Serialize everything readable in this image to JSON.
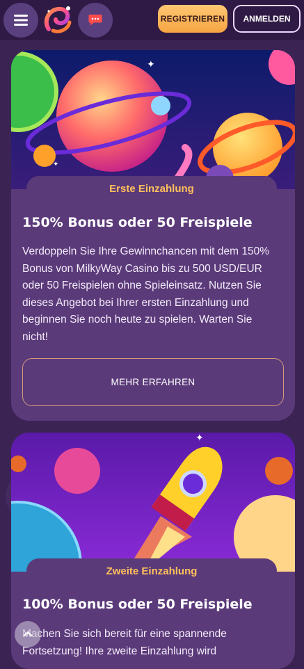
{
  "header": {
    "register_label": "REGISTRIEREN",
    "login_label": "ANMELDEN"
  },
  "cards": [
    {
      "tab_label": "Erste Einzahlung",
      "title": "150% Bonus oder 50 Freispiele",
      "text": "Verdoppeln Sie Ihre Gewinnchancen mit dem 150% Bonus von MilkyWay Casino bis zu 500 USD/EUR oder 50 Freispielen ohne Spieleinsatz. Nutzen Sie dieses Angebot bei Ihrer ersten Einzahlung und beginnen Sie noch heute zu spielen. Warten Sie nicht!",
      "button_label": "MEHR ERFAHREN"
    },
    {
      "tab_label": "Zweite Einzahlung",
      "title": "100% Bonus oder 50 Freispiele",
      "text": "Machen Sie sich bereit für eine spannende Fortsetzung! Ihre zweite Einzahlung wird"
    }
  ],
  "colors": {
    "background": "#3b2454",
    "card": "#5b3a7a",
    "accent": "#ffc15a",
    "register_button": "#f6a542"
  },
  "icons": [
    "menu-icon",
    "logo",
    "chat-icon",
    "arrow-up-icon"
  ]
}
